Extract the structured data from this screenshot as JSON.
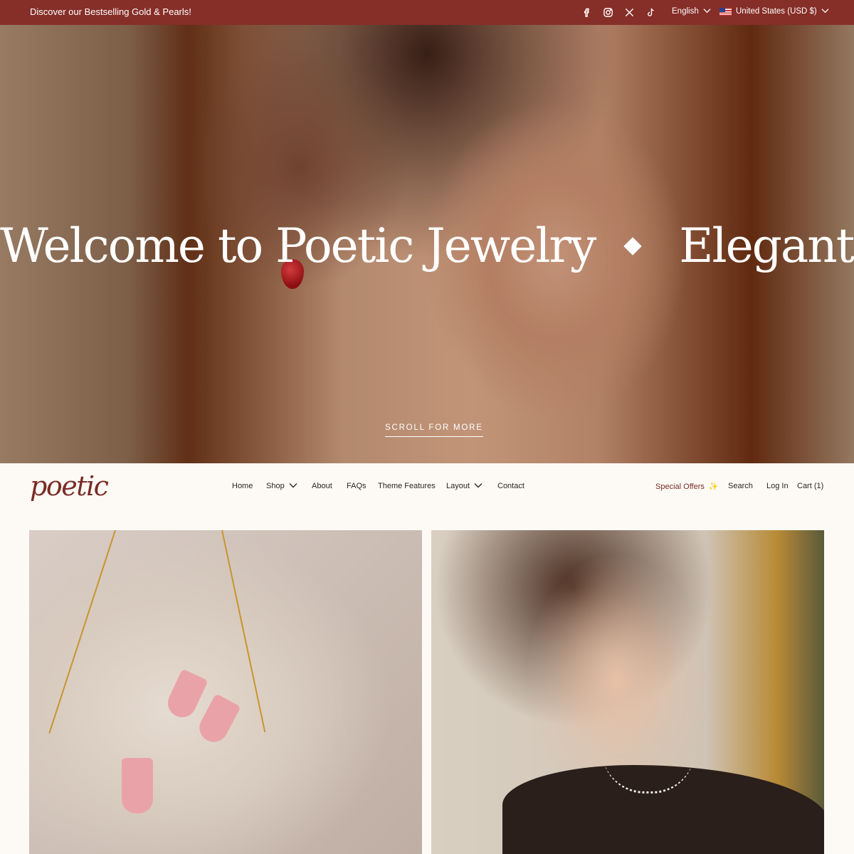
{
  "announcement": {
    "text": "Discover our Bestselling Gold & Pearls!",
    "social": [
      "facebook-icon",
      "instagram-icon",
      "x-icon",
      "tiktok-icon"
    ],
    "language": "English",
    "country": "United States (USD $)"
  },
  "hero": {
    "marquee": [
      "Welcome to Poetic Jewelry",
      "Elegant and Tin"
    ],
    "scroll_label": "SCROLL FOR MORE"
  },
  "header": {
    "logo": "poetic",
    "nav": [
      {
        "label": "Home"
      },
      {
        "label": "Shop"
      },
      {
        "label": "About"
      },
      {
        "label": "FAQs"
      },
      {
        "label": "Theme Features"
      },
      {
        "label": "Layout"
      },
      {
        "label": "Contact"
      }
    ],
    "special_offers": "Special Offers",
    "sparkle": "✨",
    "search": "Search",
    "login": "Log In",
    "cart": "Cart (1)"
  },
  "colors": {
    "brand": "#862e28",
    "logo": "#7a2b25",
    "background": "#fdfaf5"
  }
}
